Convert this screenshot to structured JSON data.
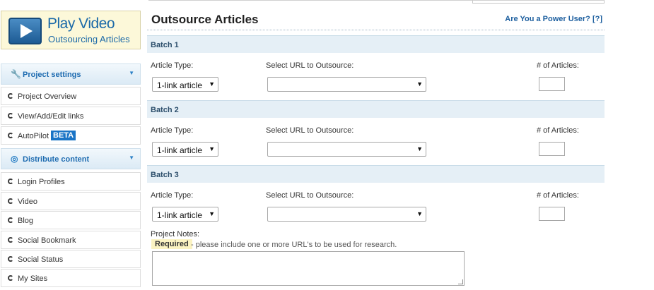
{
  "sidebar": {
    "video": {
      "title": "Play Video",
      "subtitle": "Outsourcing Articles"
    },
    "sections": [
      {
        "label": "Project settings",
        "icon": "wrench-icon",
        "items": [
          {
            "label": "Project Overview"
          },
          {
            "label": "View/Add/Edit links"
          },
          {
            "label": "AutoPilot",
            "badge": "BETA"
          }
        ]
      },
      {
        "label": "Distribute content",
        "icon": "target-icon",
        "items": [
          {
            "label": "Login Profiles"
          },
          {
            "label": "Video"
          },
          {
            "label": "Blog"
          },
          {
            "label": "Social Bookmark"
          },
          {
            "label": "Social Status"
          },
          {
            "label": "My Sites"
          }
        ]
      }
    ]
  },
  "main": {
    "title": "Outsource Articles",
    "power_link": "Are You a Power User? [?]",
    "labels": {
      "article_type": "Article Type:",
      "url": "Select URL to Outsource:",
      "count": "# of Articles:"
    },
    "batches": [
      {
        "title": "Batch 1",
        "article_type": "1-link article",
        "url": "",
        "count": ""
      },
      {
        "title": "Batch 2",
        "article_type": "1-link article",
        "url": "",
        "count": ""
      },
      {
        "title": "Batch 3",
        "article_type": "1-link article",
        "url": "",
        "count": ""
      }
    ],
    "notes": {
      "label": "Project Notes:",
      "required": "Required",
      "hint": "- please include one or more URL's to be used for research.",
      "value": ""
    }
  },
  "colors": {
    "accent": "#1d6bb0",
    "batch_header": "#e5eff6",
    "required_bg": "#fbf3c2",
    "video_bg": "#fcf8d9"
  }
}
